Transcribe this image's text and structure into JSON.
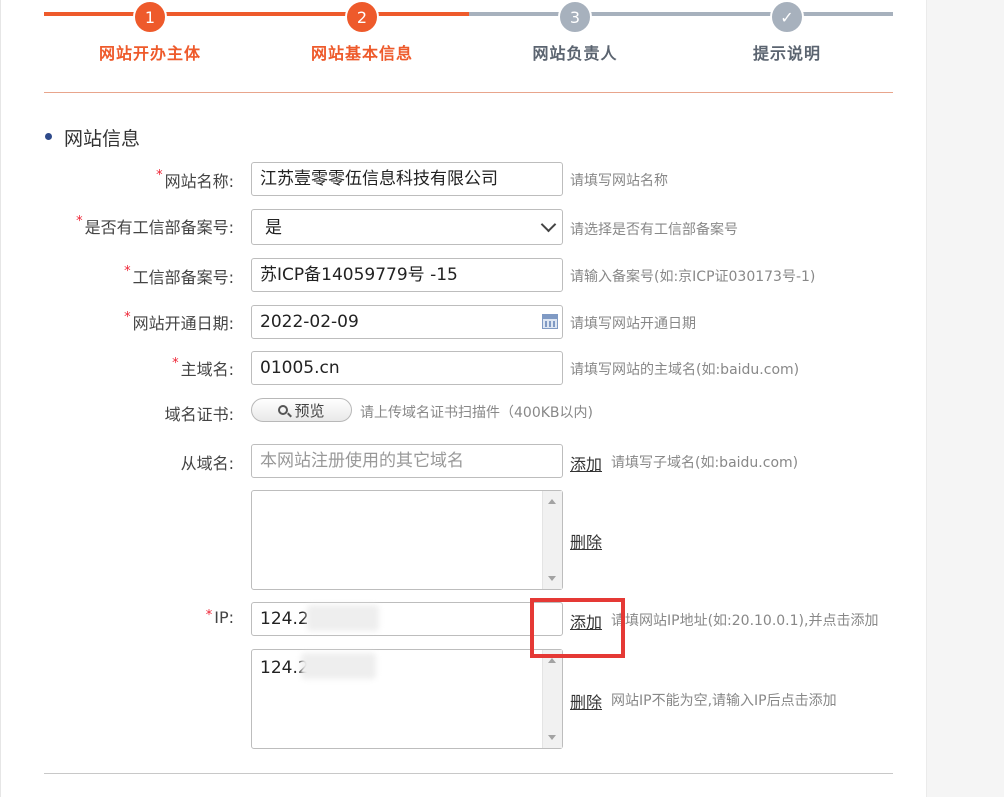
{
  "steps": [
    {
      "number": "1",
      "label": "网站开办主体",
      "state": "active"
    },
    {
      "number": "2",
      "label": "网站基本信息",
      "state": "active"
    },
    {
      "number": "3",
      "label": "网站负责人",
      "state": "inactive"
    },
    {
      "number": "✓",
      "label": "提示说明",
      "state": "inactive"
    }
  ],
  "section": {
    "title": "网站信息"
  },
  "form": {
    "site_name": {
      "label": "网站名称:",
      "value": "江苏壹零零伍信息科技有限公司",
      "hint": "请填写网站名称"
    },
    "has_record": {
      "label": "是否有工信部备案号:",
      "value": "是",
      "hint": "请选择是否有工信部备案号"
    },
    "record_no": {
      "label": "工信部备案号:",
      "value": "苏ICP备14059779号 -15",
      "hint": "请输入备案号(如:京ICP证030173号-1)"
    },
    "open_date": {
      "label": "网站开通日期:",
      "value": "2022-02-09",
      "hint": "请填写网站开通日期"
    },
    "main_domain": {
      "label": "主域名:",
      "value": "01005.cn",
      "hint": "请填写网站的主域名(如:baidu.com)"
    },
    "domain_cert": {
      "label": "域名证书:",
      "button": "预览",
      "hint": "请上传域名证书扫描件（400KB以内)"
    },
    "sub_domain": {
      "label": "从域名:",
      "placeholder": "本网站注册使用的其它域名",
      "add": "添加",
      "hint": "请填写子域名(如:baidu.com)",
      "delete": "删除"
    },
    "ip": {
      "label": "IP:",
      "value": "124.2",
      "list_value": "124.2",
      "add": "添加",
      "hint": "请填网站IP地址(如:20.10.0.1),并点击添加",
      "delete": "删除",
      "delete_hint": "网站IP不能为空,请输入IP后点击添加"
    }
  },
  "colors": {
    "accent": "#ee5a2b",
    "inactive": "#a7b1bd",
    "highlight": "#e53935"
  }
}
